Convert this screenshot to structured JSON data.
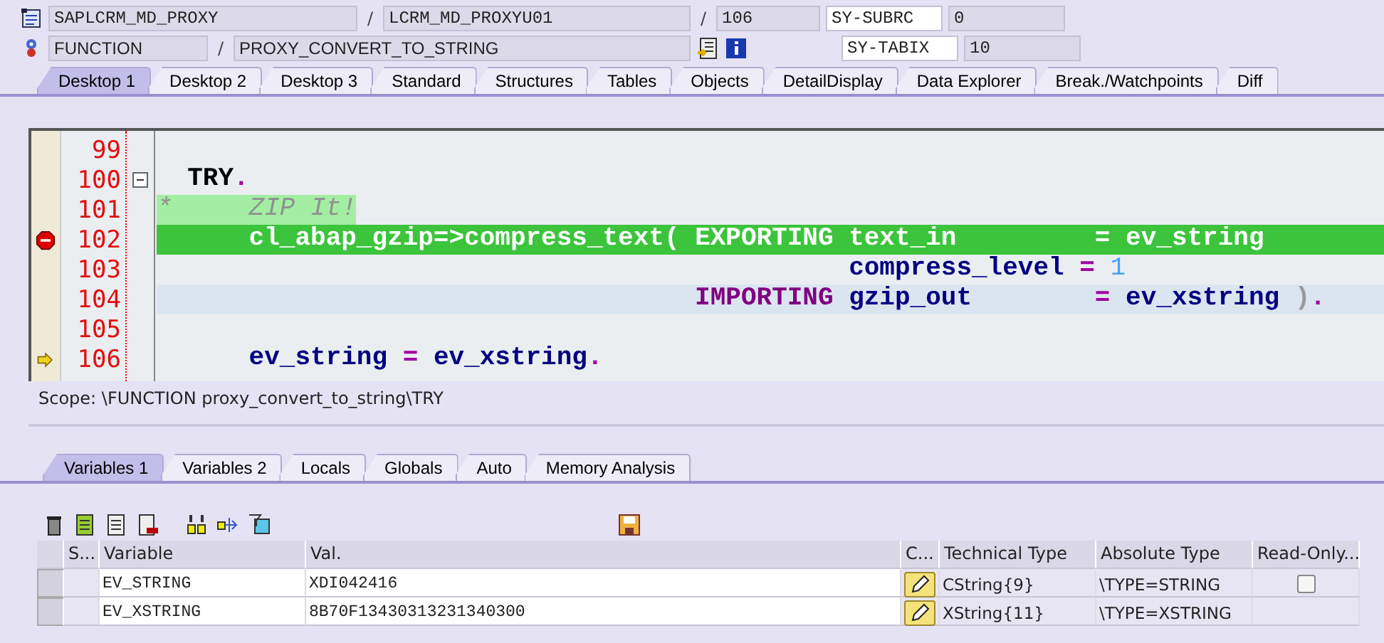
{
  "header": {
    "program": "SAPLCRM_MD_PROXY",
    "include": "LCRM_MD_PROXYU01",
    "line": "106",
    "event_type": "FUNCTION",
    "event_name": "PROXY_CONVERT_TO_STRING",
    "separators": [
      "/",
      "/",
      "/"
    ],
    "sys_fields": [
      {
        "name": "SY-SUBRC",
        "value": "0"
      },
      {
        "name": "SY-TABIX",
        "value": "10"
      }
    ]
  },
  "tabs": [
    {
      "label": "Desktop 1",
      "selected": true
    },
    {
      "label": "Desktop 2",
      "selected": false
    },
    {
      "label": "Desktop 3",
      "selected": false
    },
    {
      "label": "Standard",
      "selected": false
    },
    {
      "label": "Structures",
      "selected": false
    },
    {
      "label": "Tables",
      "selected": false
    },
    {
      "label": "Objects",
      "selected": false
    },
    {
      "label": "DetailDisplay",
      "selected": false
    },
    {
      "label": "Data Explorer",
      "selected": false
    },
    {
      "label": "Break./Watchpoints",
      "selected": false
    },
    {
      "label": "Diff",
      "selected": false
    }
  ],
  "code": [
    {
      "number": "99",
      "breakpoint": false,
      "execution_pointer": false
    },
    {
      "number": "100",
      "kind": "normal",
      "breakpoint": false,
      "execution_pointer": false,
      "fold": true,
      "tokens": [
        {
          "kind": "keyword",
          "text": "  TRY"
        },
        {
          "kind": "op",
          "text": "."
        }
      ]
    },
    {
      "number": "101",
      "kind": "comment",
      "breakpoint": false,
      "execution_pointer": false,
      "tokens": [
        {
          "kind": "comment",
          "text": "*     ZIP It!"
        }
      ]
    },
    {
      "number": "102",
      "kind": "current",
      "breakpoint": true,
      "execution_pointer": false,
      "tokens": [
        {
          "kind": "ident",
          "text": "      cl_abap_gzip=>compress_text( "
        },
        {
          "kind": "param",
          "text": "EXPORTING"
        },
        {
          "kind": "ident",
          "text": " text_in         "
        },
        {
          "kind": "op",
          "text": "="
        },
        {
          "kind": "ident",
          "text": " ev_string"
        }
      ]
    },
    {
      "number": "103",
      "kind": "normal",
      "breakpoint": false,
      "execution_pointer": false,
      "tokens": [
        {
          "kind": "ident",
          "text": "                                             compress_level "
        },
        {
          "kind": "op",
          "text": "="
        },
        {
          "kind": "number",
          "text": " 1"
        }
      ]
    },
    {
      "number": "104",
      "kind": "selected",
      "breakpoint": false,
      "execution_pointer": false,
      "tokens": [
        {
          "kind": "param",
          "text": "                                   IMPORTING"
        },
        {
          "kind": "ident",
          "text": " gzip_out        "
        },
        {
          "kind": "op",
          "text": "="
        },
        {
          "kind": "ident",
          "text": " ev_xstring "
        },
        {
          "kind": "punct",
          "text": ")"
        },
        {
          "kind": "op",
          "text": "."
        }
      ]
    },
    {
      "number": "105",
      "breakpoint": false,
      "execution_pointer": false
    },
    {
      "number": "106",
      "kind": "normal",
      "breakpoint": false,
      "execution_pointer": true,
      "tokens": [
        {
          "kind": "ident",
          "text": "      ev_string "
        },
        {
          "kind": "op",
          "text": "="
        },
        {
          "kind": "ident",
          "text": " ev_xstring"
        },
        {
          "kind": "op",
          "text": "."
        }
      ]
    }
  ],
  "scope": "Scope: \\FUNCTION proxy_convert_to_string\\TRY",
  "var_tabs": [
    {
      "label": "Variables 1",
      "selected": true
    },
    {
      "label": "Variables 2",
      "selected": false
    },
    {
      "label": "Locals",
      "selected": false
    },
    {
      "label": "Globals",
      "selected": false
    },
    {
      "label": "Auto",
      "selected": false
    },
    {
      "label": "Memory Analysis",
      "selected": false
    }
  ],
  "table": {
    "columns": [
      "S...",
      "Variable",
      "Val.",
      "C...",
      "Technical Type",
      "Absolute Type",
      "Read-Only..."
    ],
    "rows": [
      {
        "variable": "EV_STRING",
        "value": "XDI042416",
        "technical_type": "CString{9}",
        "absolute_type": "\\TYPE=STRING",
        "read_only": false
      },
      {
        "variable": "EV_XSTRING",
        "value": "8B70F13430313231340300",
        "technical_type": "XString{11}",
        "absolute_type": "\\TYPE=XSTRING"
      }
    ]
  }
}
